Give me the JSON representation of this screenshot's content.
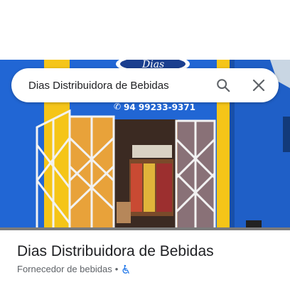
{
  "search": {
    "query": "Dias Distribuidora de Bebidas",
    "search_icon": "search-icon",
    "close_icon": "close-icon"
  },
  "photo": {
    "sign_phone": "94 99233-9371",
    "sign_logo_text": "Dias",
    "colors": {
      "wall": "#2166d4",
      "trim": "#f5c518"
    }
  },
  "place": {
    "name": "Dias Distribuidora de Bebidas",
    "category": "Fornecedor de bebidas",
    "separator": "•",
    "accessibility_icon": "wheelchair-icon",
    "accent": "#1a73e8"
  }
}
